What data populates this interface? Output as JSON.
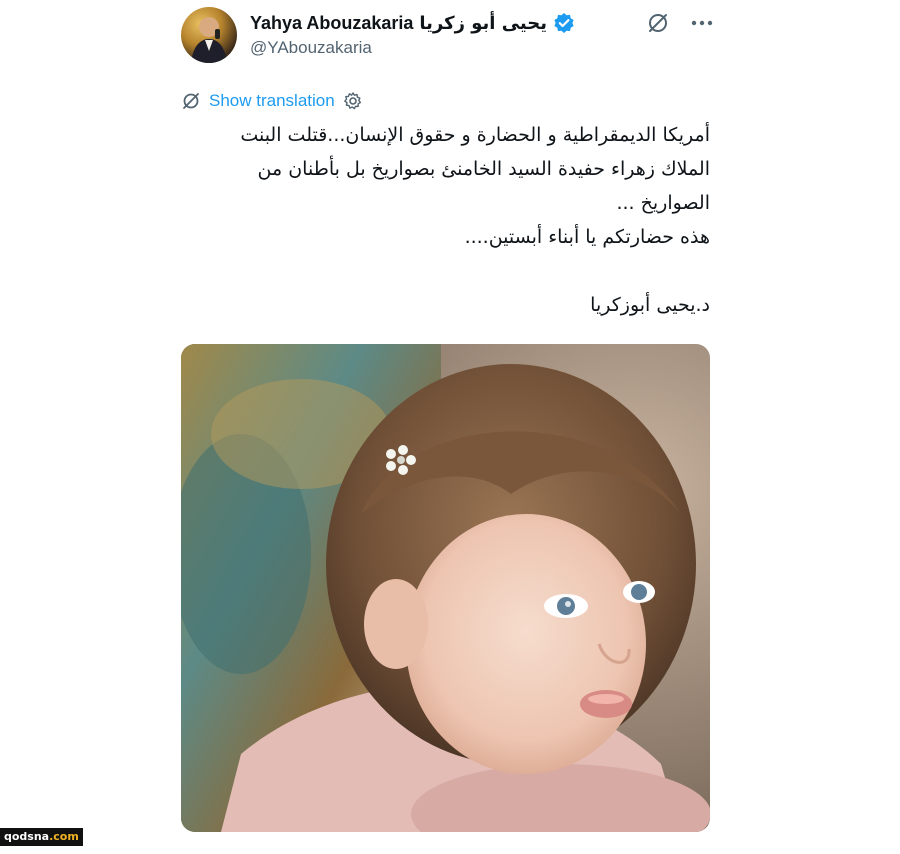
{
  "tweet": {
    "display_name_latin": "Yahya Abouzakaria",
    "display_name_arabic": "يحيى أبو زكريا",
    "handle": "@YAbouzakaria",
    "show_translation_label": "Show translation",
    "body_lines": [
      "أمريكا الديمقراطية و الحضارة و حقوق الإنسان...قتلت البنت",
      "الملاك زهراء حفيدة السيد الخامنئ بصواريخ بل بأطنان من",
      "الصواريخ ...",
      "هذه حضارتكم يا أبناء أبستين...."
    ],
    "signature": "د.يحيى أبوزكريا"
  },
  "icons": {
    "verified": "verified-badge-icon",
    "grok": "grok-icon",
    "more": "more-options-icon",
    "translate": "translate-icon",
    "settings": "gear-icon"
  },
  "colors": {
    "accent": "#1d9bf0",
    "text": "#0f1419",
    "muted": "#536471"
  },
  "watermark": {
    "main": "qodsna",
    "suffix": ".com"
  }
}
